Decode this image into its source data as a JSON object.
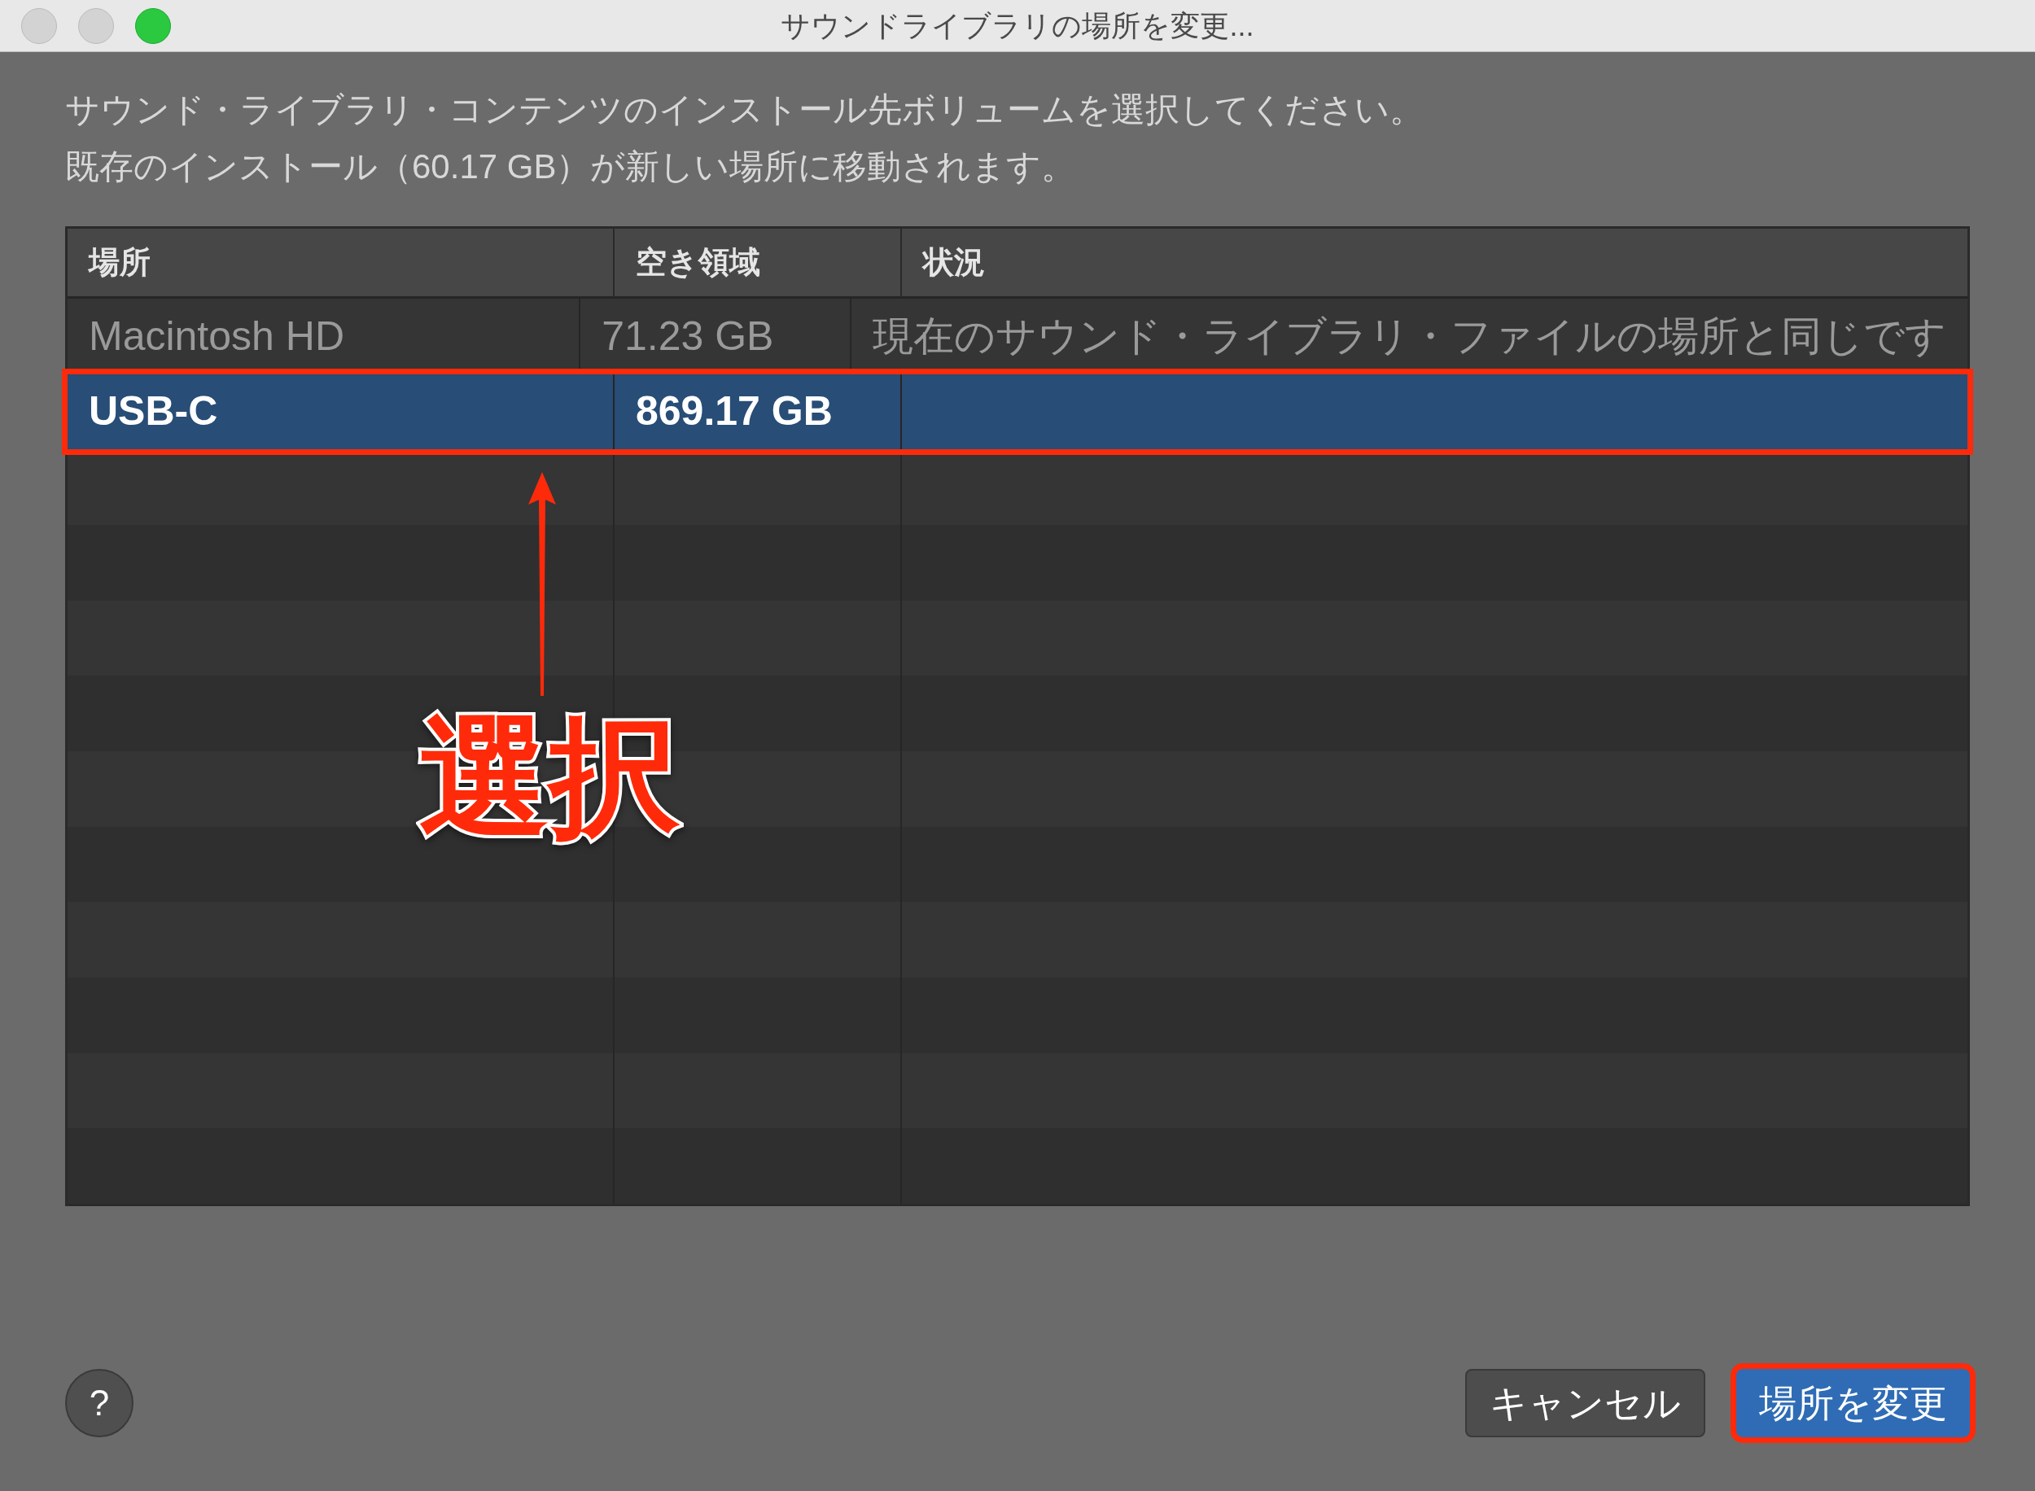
{
  "window": {
    "title": "サウンドライブラリの場所を変更..."
  },
  "message": [
    "サウンド・ライブラリ・コンテンツのインストール先ボリュームを選択してください。",
    "既存のインストール（60.17 GB）が新しい場所に移動されます。"
  ],
  "table": {
    "columns": [
      "場所",
      "空き領域",
      "状況"
    ],
    "rows": [
      {
        "cells": [
          "Macintosh HD",
          "71.23 GB",
          "現在のサウンド・ライブラリ・ファイルの場所と同じです"
        ],
        "disabled": true,
        "selected": false,
        "highlighted": false
      },
      {
        "cells": [
          "USB-C",
          "869.17 GB",
          ""
        ],
        "disabled": false,
        "selected": true,
        "highlighted": true
      }
    ]
  },
  "annotation": {
    "label": "選択"
  },
  "help_button": {
    "label": "?"
  },
  "buttons": [
    {
      "label": "キャンセル",
      "default": false,
      "highlighted": false
    },
    {
      "label": "場所を変更",
      "default": true,
      "highlighted": true
    }
  ]
}
